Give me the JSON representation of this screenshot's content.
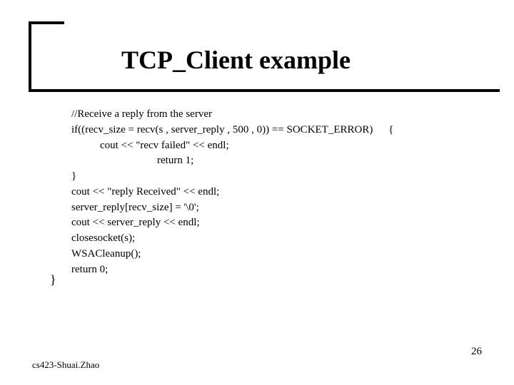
{
  "title": "TCP_Client example",
  "code": {
    "line1": "//Receive a reply from the server",
    "line2a": "if((recv_size = recv(s , server_reply , 500 , 0)) == SOCKET_ERROR)",
    "line2b": "{",
    "line3": "cout << \"recv failed\" << endl;",
    "line4": "return 1;",
    "line5": "}",
    "line6": "cout << \"reply Received\" << endl;",
    "line7": "server_reply[recv_size] = '\\0';",
    "line8": "cout << server_reply << endl;",
    "line9": "closesocket(s);",
    "line10": "WSACleanup();",
    "line11": "return 0;"
  },
  "close_brace": "}",
  "footer": {
    "left": "cs423-Shuai.Zhao",
    "right": "26"
  }
}
